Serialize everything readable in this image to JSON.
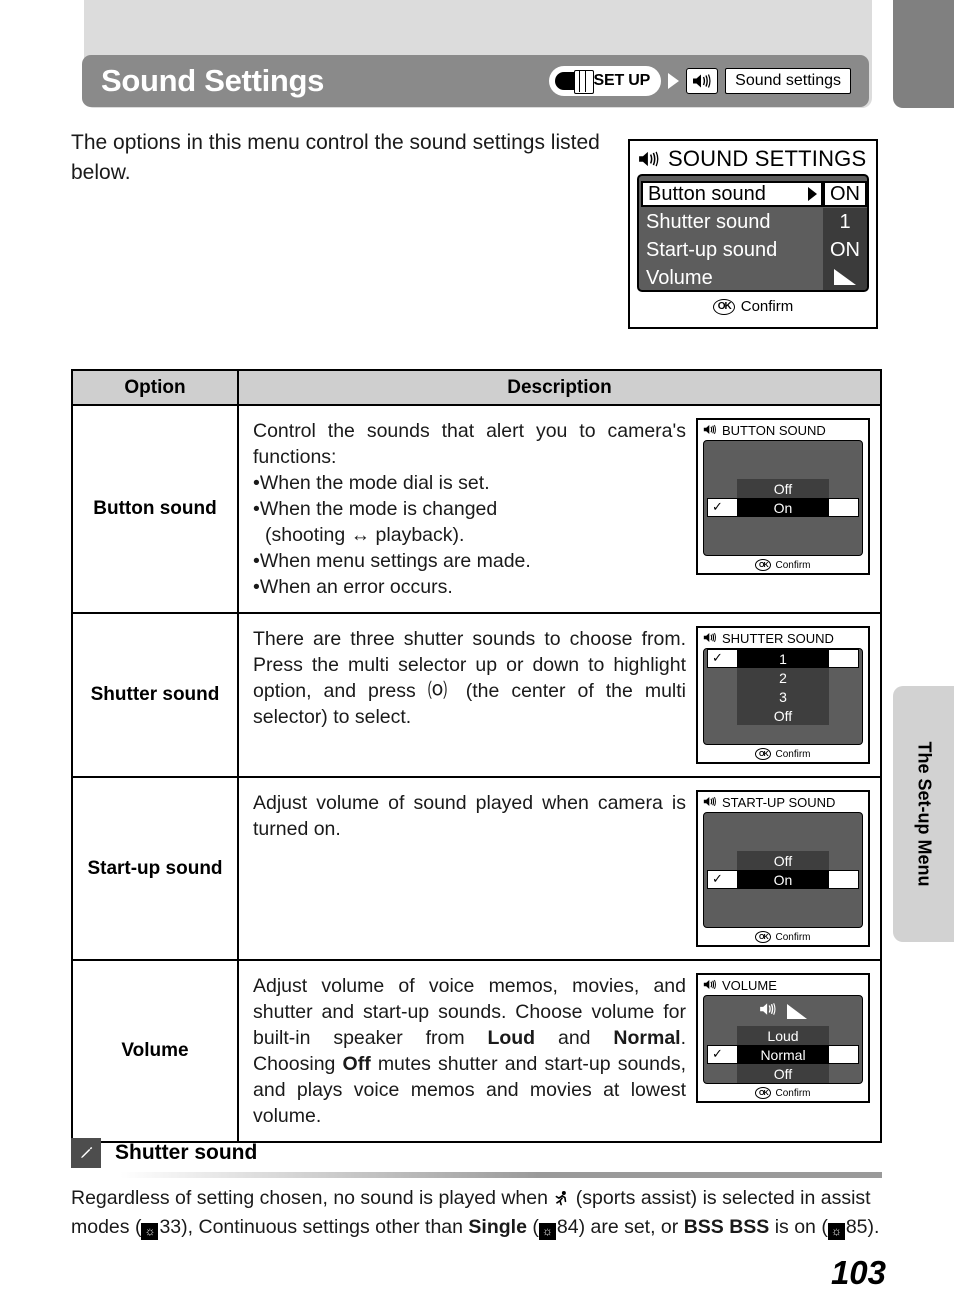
{
  "header": {
    "title": "Sound Settings",
    "breadcrumb": {
      "setup_label": "SET UP",
      "speaker_icon": "speaker-icon",
      "menu_label": "Sound settings"
    }
  },
  "intro": "The options in this menu control the sound settings listed below.",
  "main_lcd": {
    "title": "SOUND SETTINGS",
    "rows": [
      {
        "name": "Button sound",
        "value": "ON",
        "selected": true,
        "value_is_icon": false
      },
      {
        "name": "Shutter sound",
        "value": "1",
        "selected": false,
        "value_is_icon": false
      },
      {
        "name": "Start-up sound",
        "value": "ON",
        "selected": false,
        "value_is_icon": false
      },
      {
        "name": "Volume",
        "value": "",
        "selected": false,
        "value_is_icon": true
      }
    ],
    "footer": {
      "badge": "OK",
      "label": "Confirm"
    }
  },
  "table": {
    "headers": {
      "option": "Option",
      "description": "Description"
    },
    "rows": [
      {
        "option": "Button sound",
        "description_lines": [
          "Control the sounds that alert you to camera's functions:",
          "•When the mode dial is set.",
          "•When the mode is changed",
          "(shooting ↔ playback).",
          "•When menu settings are made.",
          "•When an error occurs."
        ],
        "lcd": {
          "title": "BUTTON SOUND",
          "top_blanks": 2,
          "items": [
            {
              "label": "Off",
              "selected": false
            },
            {
              "label": "On",
              "selected": true
            }
          ],
          "bottom_blanks": 2,
          "footer": {
            "badge": "OK",
            "label": "Confirm"
          }
        }
      },
      {
        "option": "Shutter sound",
        "description_lines": [
          "There are three shutter sounds to choose from. Press the multi selector up or down to highlight option, and press ⒪ (the center of the multi selector) to select."
        ],
        "lcd": {
          "title": "SHUTTER SOUND",
          "top_blanks": 0,
          "items": [
            {
              "label": "1",
              "selected": true
            },
            {
              "label": "2",
              "selected": false
            },
            {
              "label": "3",
              "selected": false
            },
            {
              "label": "Off",
              "selected": false
            }
          ],
          "bottom_blanks": 1,
          "footer": {
            "badge": "OK",
            "label": "Confirm"
          }
        }
      },
      {
        "option": "Start-up sound",
        "description_lines": [
          "Adjust volume of sound played when camera is turned on."
        ],
        "lcd": {
          "title": "START-UP SOUND",
          "top_blanks": 2,
          "items": [
            {
              "label": "Off",
              "selected": false
            },
            {
              "label": "On",
              "selected": true
            }
          ],
          "bottom_blanks": 2,
          "footer": {
            "badge": "OK",
            "label": "Confirm"
          }
        }
      },
      {
        "option": "Volume",
        "description_lines": [
          "Adjust volume of voice memos, movies, and shutter and start-up sounds. Choose volume for built-in speaker from Loud and Normal. Choosing Off mutes shutter and start-up sounds, and plays voice memos and movies at lowest volume."
        ],
        "lcd": {
          "title": "VOLUME",
          "has_volume_icons": true,
          "items": [
            {
              "label": "Loud",
              "selected": false
            },
            {
              "label": "Normal",
              "selected": true
            },
            {
              "label": "Off",
              "selected": false
            }
          ],
          "footer": {
            "badge": "OK",
            "label": "Confirm"
          }
        }
      }
    ]
  },
  "side_tab": {
    "label": "The Set-up Menu"
  },
  "note": {
    "icon": "pencil-icon",
    "title": "Shutter sound",
    "line1_a": "Regardless of setting chosen, no sound is played when ",
    "line1_sports_icon": "sports-assist-icon",
    "line1_b": " (sports assist) is selected in assist modes (",
    "ref1": "33",
    "line2_a": "), Continuous settings other than ",
    "bold1": "Single",
    "line2_b": " (",
    "ref2": "84",
    "line2_c": ") are set, or ",
    "bss": "BSS BSS",
    "line2_d": " is on (",
    "ref3": "85",
    "line2_e": ")."
  },
  "page_number": "103",
  "colors": {
    "header_bar": "#8a8a8a",
    "top_panel": "#dcdcdc",
    "top_tab": "#808080",
    "side_tab": "#d2d2d2",
    "table_header": "#cfcfcf",
    "lcd_panel": "#5d5d5d",
    "lcd_row": "#3e3e3e"
  }
}
